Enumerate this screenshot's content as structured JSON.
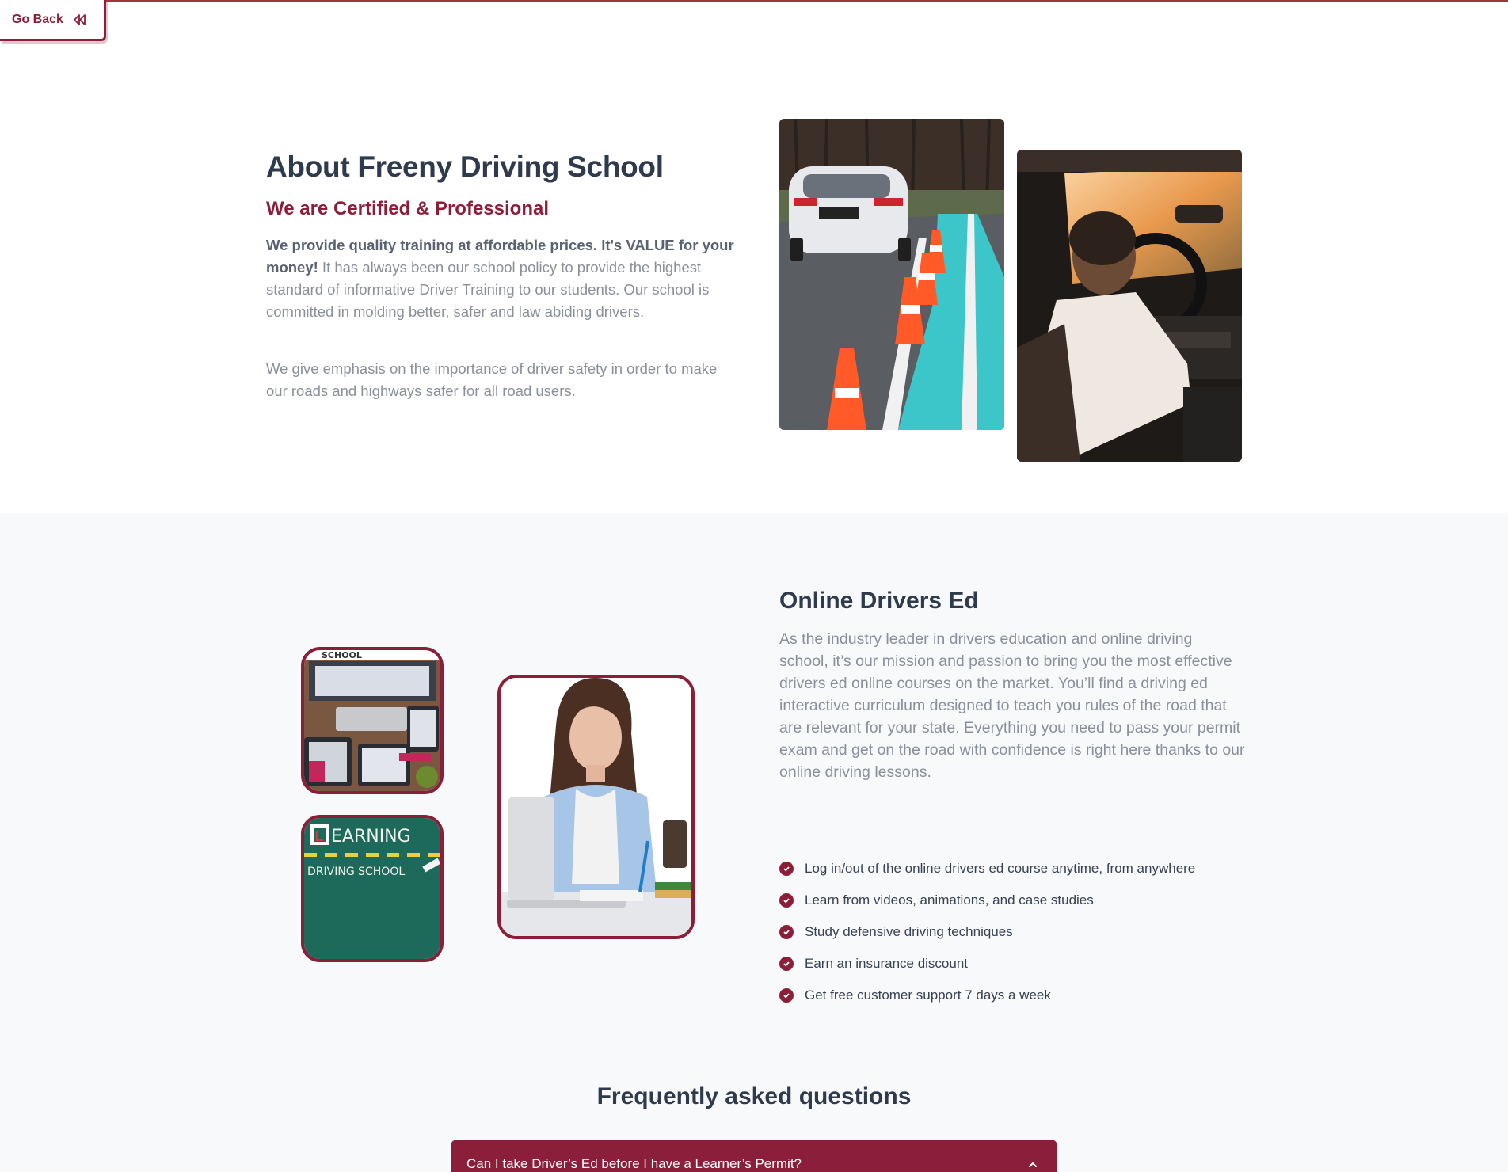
{
  "nav": {
    "go_back_label": "Go Back",
    "go_back_icon": "rewind-icon"
  },
  "about": {
    "title": "About Freeny Driving School",
    "subtitle": "We are Certified & Professional",
    "paragraph1_bold": "We provide quality training at affordable prices. It's VALUE for your money!",
    "paragraph1_rest": " It has always been our school policy to provide the highest standard of informative Driver Training to our students. Our school is committed in molding better, safer and law abiding drivers.",
    "paragraph2": "We give emphasis on the importance of driver safety in order to make our roads and highways safer for all road users."
  },
  "online": {
    "title": "Online Drivers Ed",
    "paragraph": "As the industry leader in drivers education and online driving school, it’s our mission and passion to bring you the most effective drivers ed online courses on the market. You’ll find a driving ed interactive curriculum designed to teach you rules of the road that are relevant for your state. Everything you need to pass your permit exam and get on the road with confidence is right here thanks to our online driving lessons.",
    "features": [
      "Log in/out of the online drivers ed course anytime, from anywhere",
      "Learn from videos, animations, and case studies",
      "Study defensive driving techniques",
      "Earn an insurance discount",
      "Get free customer support 7 days a week"
    ],
    "image_learning_text1": "EARNING",
    "image_learning_letter": "L",
    "image_learning_text2": "DRIVING SCHOOL",
    "image_school_text": "SCHOOL"
  },
  "faq": {
    "title": "Frequently asked questions",
    "items": [
      {
        "question": "Can I take Driver’s Ed before I have a Learner’s Permit?",
        "expanded": true
      }
    ]
  },
  "colors": {
    "brand": "#8b1f3a",
    "heading": "#2f3a4d",
    "muted": "#8a8f99"
  }
}
